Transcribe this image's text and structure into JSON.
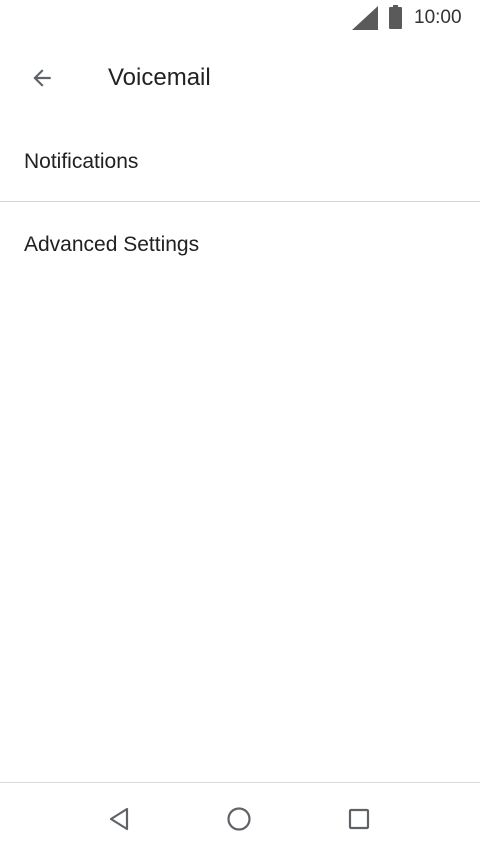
{
  "status_bar": {
    "time": "10:00",
    "signal_icon": "cell-signal-icon",
    "battery_icon": "battery-icon"
  },
  "toolbar": {
    "back_icon": "arrow-back-icon",
    "title": "Voicemail"
  },
  "settings": {
    "items": [
      {
        "label": "Notifications"
      },
      {
        "label": "Advanced Settings"
      }
    ]
  },
  "nav_bar": {
    "back_icon": "triangle-back-icon",
    "home_icon": "circle-home-icon",
    "recents_icon": "square-recents-icon"
  },
  "colors": {
    "background": "#ffffff",
    "text_primary": "#212121",
    "icon_gray": "#5f6368",
    "divider": "#d6d6d6"
  }
}
